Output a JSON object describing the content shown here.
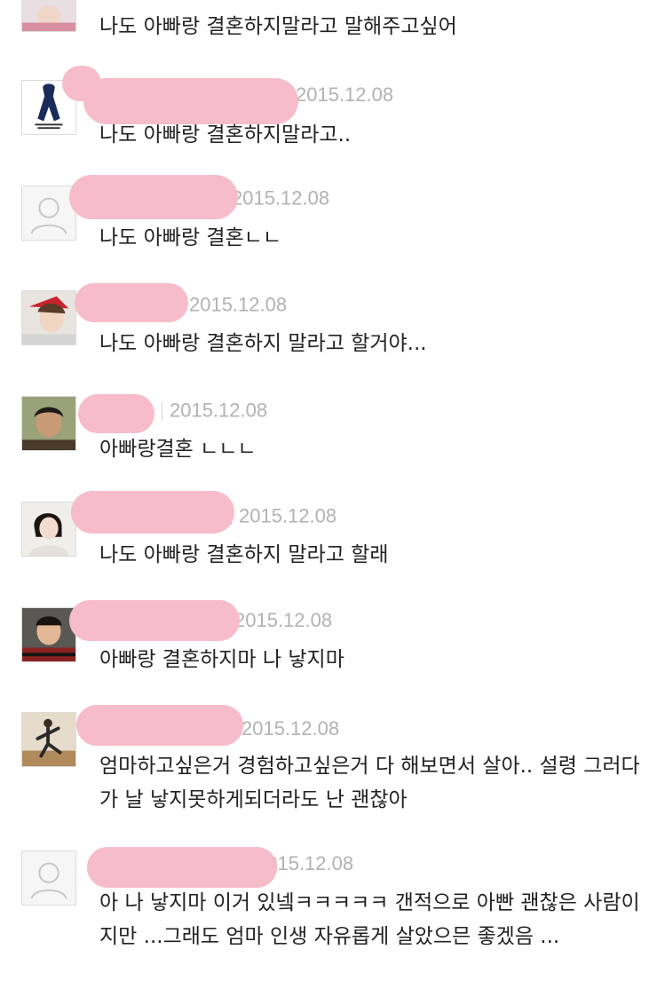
{
  "comments": [
    {
      "date": "",
      "text": "나도 아빠랑 결혼하지말라고 말해주고싶어"
    },
    {
      "date": "2015.12.08",
      "text": "나도 아빠랑 결혼하지말라고.."
    },
    {
      "date": "2015.12.08",
      "text": "나도 아빠랑 결혼ㄴㄴ"
    },
    {
      "date": "2015.12.08",
      "text": "나도 아빠랑 결혼하지 말라고 할거야..."
    },
    {
      "date": "2015.12.08",
      "text": "아빠랑결혼 ㄴㄴㄴ"
    },
    {
      "date": "2015.12.08",
      "text": "나도 아빠랑 결혼하지 말라고 할래"
    },
    {
      "date": "2015.12.08",
      "text": "아빠랑 결혼하지마 나 낳지마"
    },
    {
      "date": "2015.12.08",
      "text": "엄마하고싶은거 경험하고싶은거 다 해보면서 살아.. 설령 그러다가 날 낳지못하게되더라도 난 괜찮아"
    },
    {
      "date": "2015.12.08",
      "text": "아 나 낳지마 이거 있넼ㅋㅋㅋㅋㅋ 갠적으로 아빤 괜찮은 사람이지만 ...그래도 엄마 인생 자유롭게 살았으믄 좋겠음 ..."
    }
  ],
  "icons": {
    "ribbon": "ribbon-avatar-icon",
    "default": "default-avatar-icon"
  },
  "colors": {
    "redaction": "#f7bcc9",
    "date": "#b2b2b2",
    "text": "#222222",
    "divider": "#d9d9d9"
  }
}
